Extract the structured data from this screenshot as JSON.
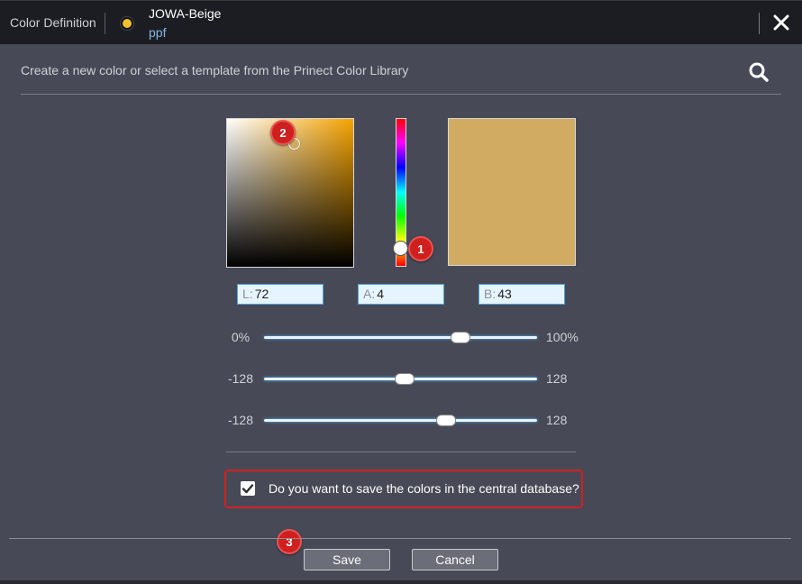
{
  "header": {
    "title": "Color Definition",
    "color_name": "JOWA-Beige",
    "color_sub": "ppf",
    "dot_color": "#f2c12e"
  },
  "intro": {
    "text": "Create a new color or select a template from the Prinect Color Library"
  },
  "picker": {
    "preview_color": "#d1ab61",
    "hue_color": "#f5a300"
  },
  "lab": {
    "l_label": "L:",
    "l_value": "72",
    "a_label": "A:",
    "a_value": "4",
    "b_label": "B:",
    "b_value": "43"
  },
  "sliders": [
    {
      "min": "0%",
      "max": "100%",
      "value": 72,
      "range": [
        0,
        100
      ]
    },
    {
      "min": "-128",
      "max": "128",
      "value": 4,
      "range": [
        -128,
        128
      ]
    },
    {
      "min": "-128",
      "max": "128",
      "value": 43,
      "range": [
        -128,
        128
      ]
    }
  ],
  "badges": [
    "1",
    "2",
    "3"
  ],
  "save_db": {
    "checked": true,
    "label": "Do you want to save the colors in the central database?"
  },
  "buttons": {
    "save": "Save",
    "cancel": "Cancel"
  }
}
